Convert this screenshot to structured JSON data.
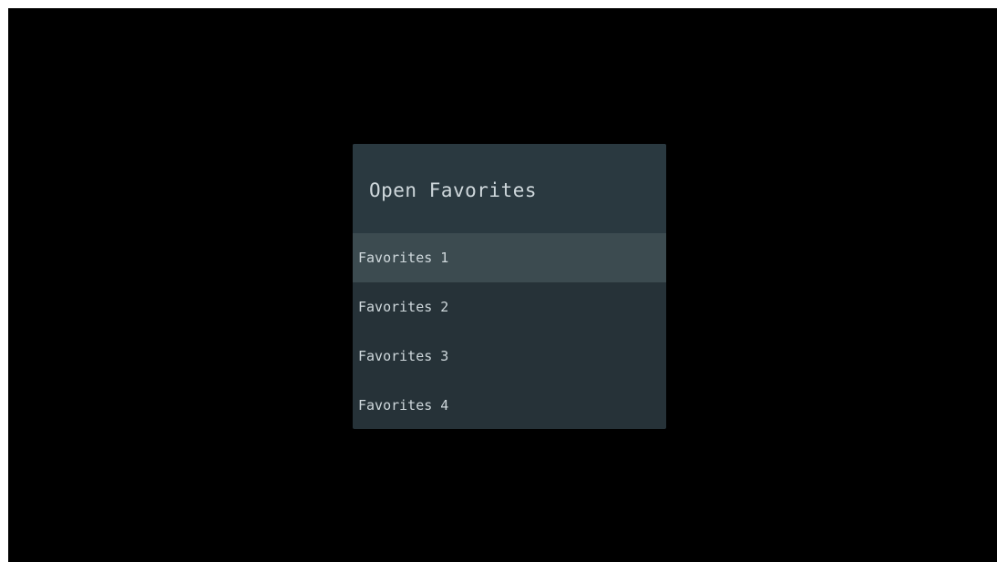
{
  "dialog": {
    "title": "Open Favorites",
    "items": [
      {
        "label": "Favorites 1",
        "selected": true
      },
      {
        "label": "Favorites 2",
        "selected": false
      },
      {
        "label": "Favorites 3",
        "selected": false
      },
      {
        "label": "Favorites 4",
        "selected": false
      }
    ]
  },
  "colors": {
    "screen_background": "#000000",
    "dialog_background": "#263238",
    "title_background": "#2a3940",
    "selected_item_background": "#3c4b50",
    "text": "#cfd8dc"
  }
}
